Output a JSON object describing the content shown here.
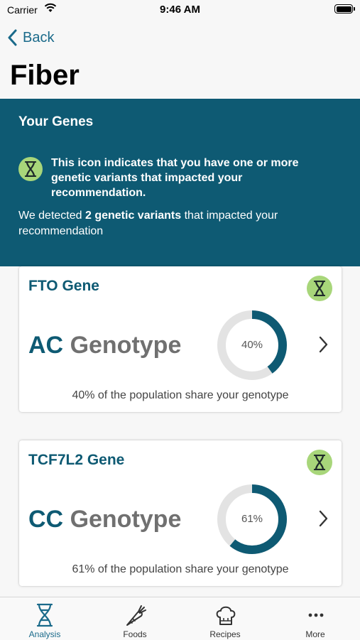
{
  "status_bar": {
    "carrier": "Carrier",
    "time": "9:46 AM"
  },
  "nav": {
    "back_label": "Back",
    "title": "Fiber"
  },
  "genes_panel": {
    "title": "Your Genes",
    "icon_note": "This icon indicates that you have one or more genetic variants that impacted your recommendation.",
    "variants_prefix": "We detected ",
    "variants_bold": "2 genetic variants",
    "variants_suffix": " that impacted your recommendation"
  },
  "gene_cards": [
    {
      "gene": "FTO Gene",
      "genotype_code": "AC",
      "genotype_label": "Genotype",
      "percent": 40,
      "percent_label": "40%",
      "share_text": "40% of the population share your genotype"
    },
    {
      "gene": "TCF7L2 Gene",
      "genotype_code": "CC",
      "genotype_label": "Genotype",
      "percent": 61,
      "percent_label": "61%",
      "share_text": "61% of the population share your genotype"
    }
  ],
  "tab_bar": {
    "tabs": [
      {
        "label": "Analysis",
        "icon": "dna-icon",
        "active": true
      },
      {
        "label": "Foods",
        "icon": "carrot-icon",
        "active": false
      },
      {
        "label": "Recipes",
        "icon": "chef-hat-icon",
        "active": false
      },
      {
        "label": "More",
        "icon": "more-icon",
        "active": false
      }
    ]
  },
  "colors": {
    "primary": "#0e5a73",
    "accent": "#1a6a8a",
    "badge": "#a8d67a",
    "donut_track": "#e3e3e3"
  }
}
